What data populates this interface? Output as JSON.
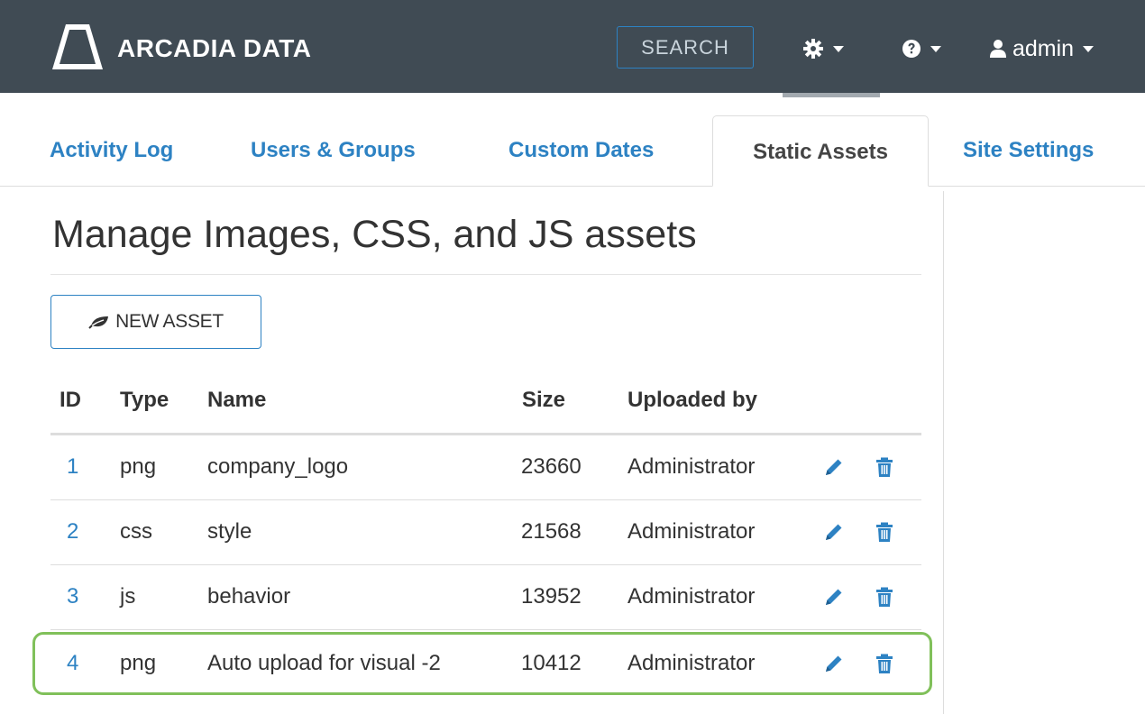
{
  "app": {
    "brand": "ARCADIA DATA",
    "search_label": "SEARCH",
    "user_label": "admin"
  },
  "icons": {
    "logo": "arcadia-triangle-logo",
    "settings": "gear-icon",
    "help": "question-circle-icon",
    "user": "user-icon",
    "new_asset": "leaf-icon",
    "edit": "pencil-icon",
    "delete": "trash-icon"
  },
  "colors": {
    "topbar": "#404b54",
    "accent": "#2d82c3",
    "highlight": "#80c05a"
  },
  "tabs": [
    {
      "label": "Activity Log",
      "active": false
    },
    {
      "label": "Users & Groups",
      "active": false
    },
    {
      "label": "Custom Dates",
      "active": false
    },
    {
      "label": "Static Assets",
      "active": true
    },
    {
      "label": "Site Settings",
      "active": false
    }
  ],
  "main": {
    "title": "Manage Images, CSS, and JS assets",
    "new_asset_label": "NEW ASSET"
  },
  "table": {
    "columns": [
      "ID",
      "Type",
      "Name",
      "Size",
      "Uploaded by"
    ],
    "rows": [
      {
        "id": "1",
        "type": "png",
        "name": "company_logo",
        "size": "23660",
        "uploaded_by": "Administrator",
        "highlighted": false
      },
      {
        "id": "2",
        "type": "css",
        "name": "style",
        "size": "21568",
        "uploaded_by": "Administrator",
        "highlighted": false
      },
      {
        "id": "3",
        "type": "js",
        "name": "behavior",
        "size": "13952",
        "uploaded_by": "Administrator",
        "highlighted": false
      },
      {
        "id": "4",
        "type": "png",
        "name": "Auto upload for visual -2",
        "size": "10412",
        "uploaded_by": "Administrator",
        "highlighted": true
      }
    ]
  }
}
